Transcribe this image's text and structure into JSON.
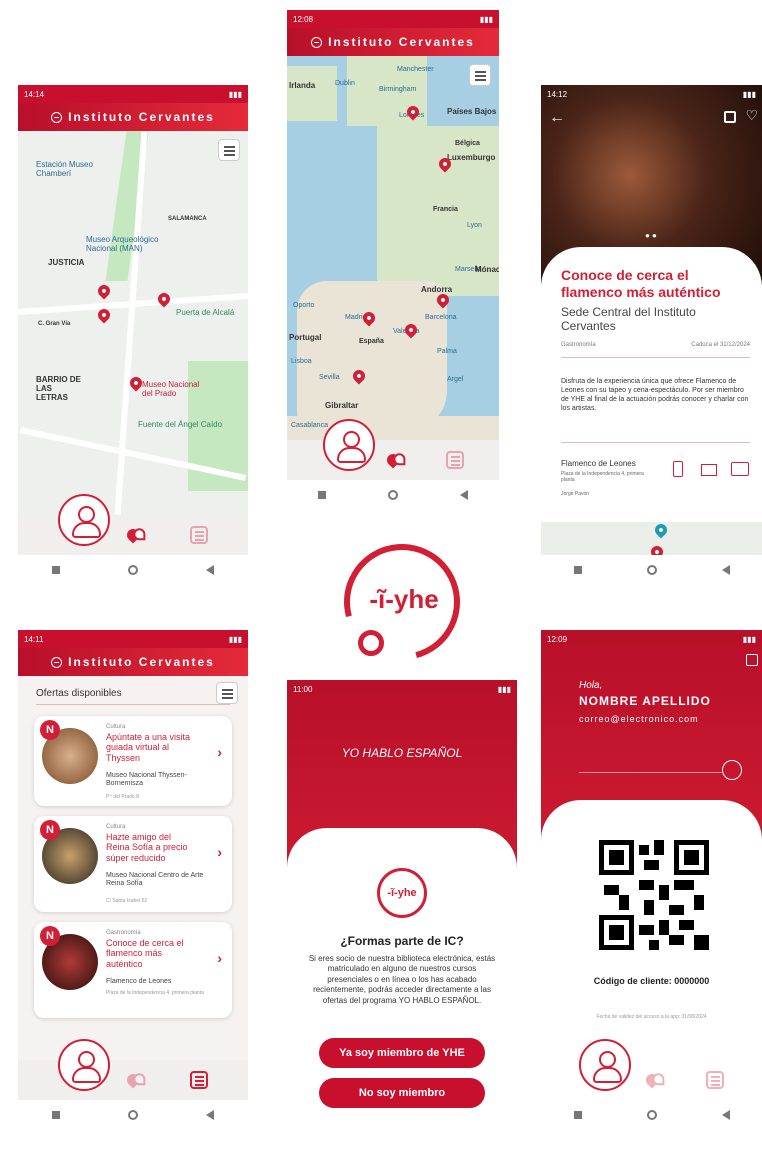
{
  "colors": {
    "brand_red": "#c8102e",
    "accent": "#d21f35"
  },
  "app_title": "Instituto Cervantes",
  "screen1": {
    "status_time": "14:14",
    "labels": {
      "estacion": "Estación Museo Chamberí",
      "museo_arq": "Museo Arqueológico Nacional (MAN)",
      "justicia": "JUSTICIA",
      "salamanca": "SALAMANCA",
      "puerta": "Puerta de Alcalá",
      "barrio": "BARRIO DE LAS LETRAS",
      "museo_prado": "Museo Nacional del Prado",
      "fuente": "Fuente del Ángel Caído",
      "gran_via": "C. Gran Vía"
    }
  },
  "screen2": {
    "status_time": "12:08",
    "labels": {
      "irlanda": "Irlanda",
      "dublin": "Dublin",
      "manchester": "Manchester",
      "birmingham": "Birmingham",
      "londres": "Londres",
      "paises_bajos": "Países Bajos",
      "belgica": "Bélgica",
      "luxemburgo": "Luxemburgo",
      "francia": "Francia",
      "lyon": "Lyon",
      "marsella": "Marsella",
      "monaco": "Mónaco",
      "andorra": "Andorra",
      "oporto": "Oporto",
      "portugal": "Portugal",
      "madrid": "Madrid",
      "espana": "España",
      "barcelona": "Barcelona",
      "valencia": "Valencia",
      "lisboa": "Lisboa",
      "sevilla": "Sevilla",
      "palma": "Palma",
      "gibraltar": "Gibraltar",
      "casablanca": "Casablanca",
      "argel": "Argel"
    }
  },
  "screen3": {
    "status_time": "14:12",
    "title": "Conoce de cerca el flamenco más auténtico",
    "venue": "Sede Central del Instituto Cervantes",
    "category": "Gastronomía",
    "expires": "Caduca el 31/12/2024",
    "description": "Disfruta de la experiencia única que ofrece Flamenco de Leones con su tapeo y cena-espectáculo. Por ser miembro de YHE al final de la actuación podrás conocer y charlar con los artistas.",
    "contact_name": "Flamenco de Leones",
    "contact_addr": "Plaza de la Independencia 4, primera planta",
    "contact_person": "Jorge Pavón"
  },
  "screen4": {
    "status_time": "14:11",
    "header": "Ofertas disponibles",
    "badge": "N",
    "offers": [
      {
        "category": "Cultura",
        "title": "Apúntate a una visita guiada virtual al Thyssen",
        "org": "Museo Nacional Thyssen-Bornemisza",
        "addr": "P.º del Prado 8"
      },
      {
        "category": "Cultura",
        "title": "Hazte amigo del Reina Sofía a precio súper reducido",
        "org": "Museo Nacional Centro de Arte Reina Sofía",
        "addr": "C/ Santa Isabel 52"
      },
      {
        "category": "Gastronomía",
        "title": "Conoce de cerca el flamenco más auténtico",
        "org": "Flamenco de Leones",
        "addr": "Plaza de la Independencia 4, primera planta"
      }
    ]
  },
  "logo": {
    "text": "yhe",
    "mark": "-ĩ-"
  },
  "screen5": {
    "status_time": "11:00",
    "heading": "YO HABLO ESPAÑOL",
    "question": "¿Formas parte de IC?",
    "body": "Si eres socio de nuestra biblioteca electrónica, estás matriculado en alguno de nuestros cursos presenciales o en línea o los has acabado recientemente, podrás acceder directamente a las ofertas del programa YO HABLO ESPAÑOL.",
    "btn_member": "Ya soy miembro de YHE",
    "btn_not_member": "No soy miembro"
  },
  "screen6": {
    "status_time": "12:09",
    "greeting": "Hola,",
    "name": "NOMBRE APELLIDO",
    "email": "correo@electronico.com",
    "client_code": "Código de cliente: 0000000",
    "validity": "Fecha de validez del acceso a la app: 31/08/2024"
  }
}
